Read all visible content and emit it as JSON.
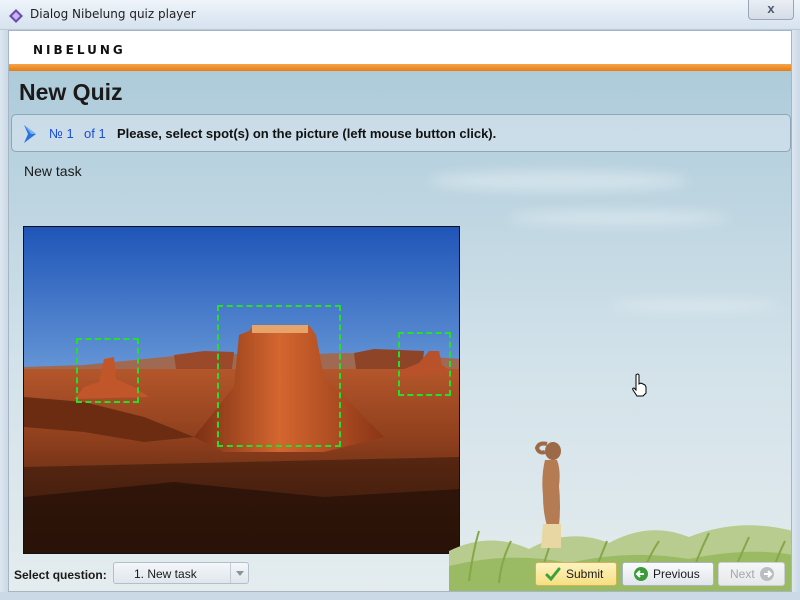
{
  "window": {
    "title": "Dialog Nibelung quiz player",
    "close_glyph": "x"
  },
  "header": {
    "logo_text": "NIBELUNG",
    "accent_color": "#e87d12"
  },
  "quiz": {
    "title": "New Quiz"
  },
  "question": {
    "number": "№ 1",
    "of_total": "of 1",
    "instruction": "Please, select spot(s) on the picture (left mouse button click).",
    "icon": "chevron-right-icon"
  },
  "task": {
    "title": "New task",
    "spot_color": "#25e02a"
  },
  "footer": {
    "select_label": "Select question:",
    "select_value": "1. New task",
    "submit_label": "Submit",
    "previous_label": "Previous",
    "next_label": "Next"
  }
}
